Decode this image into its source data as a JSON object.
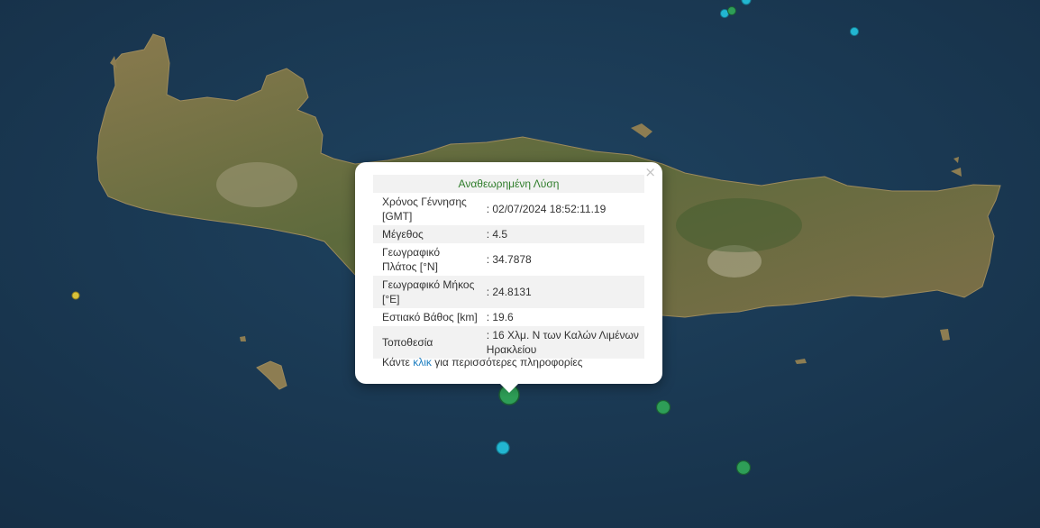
{
  "popup": {
    "header": "Αναθεωρημένη Λύση",
    "rows": [
      {
        "label": "Χρόνος Γέννησης [GMT]",
        "value": ": 02/07/2024 18:52:11.19"
      },
      {
        "label": "Μέγεθος",
        "value": ": 4.5"
      },
      {
        "label": "Γεωγραφικό Πλάτος [°N]",
        "value": ": 34.7878"
      },
      {
        "label": "Γεωγραφικό Μήκος [°E]",
        "value": ": 24.8131"
      },
      {
        "label": "Εστιακό Βάθος [km]",
        "value": ": 19.6"
      },
      {
        "label": "Τοποθεσία",
        "value": ": 16 Χλμ. Ν των Καλών Λιμένων Ηρακλείου"
      }
    ],
    "footer_pre": "Κάντε",
    "footer_link": "κλικ",
    "footer_post": "για περισσότερες πληροφορίες",
    "close_label": "×"
  },
  "colors": {
    "sea": "#1b3a55",
    "land": "#6e6a45",
    "header_green": "#2f7d2b",
    "link_blue": "#1e7fc1",
    "marker_green": "#2e9e57",
    "marker_cyan": "#22b6d1",
    "marker_yellow": "#d8c23a"
  },
  "markers": [
    {
      "name": "quake-marker-selected",
      "color": "marker_green",
      "magnitude": 4.5
    },
    {
      "name": "quake-marker-green-1",
      "color": "marker_green"
    },
    {
      "name": "quake-marker-green-2",
      "color": "marker_green"
    },
    {
      "name": "quake-marker-cyan-1",
      "color": "marker_cyan"
    },
    {
      "name": "quake-marker-cyan-2",
      "color": "marker_cyan"
    },
    {
      "name": "quake-marker-yellow",
      "color": "marker_yellow"
    },
    {
      "name": "quake-marker-north-1",
      "color": "marker_cyan"
    },
    {
      "name": "quake-marker-north-2",
      "color": "marker_green"
    },
    {
      "name": "quake-marker-north-3",
      "color": "marker_cyan"
    }
  ]
}
